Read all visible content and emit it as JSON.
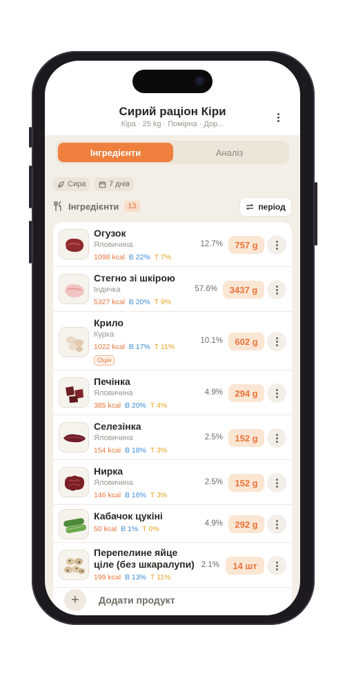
{
  "header": {
    "title": "Сирий раціон Кіри",
    "subtitle": "Кіра · 25 kg · Помірна · Дор..."
  },
  "tabs": [
    {
      "label": "Інгредієнти",
      "active": true
    },
    {
      "label": "Аналіз",
      "active": false
    }
  ],
  "chips": [
    {
      "label": "Сира",
      "icon": "leaf-icon"
    },
    {
      "label": "7 днів",
      "icon": "calendar-icon"
    }
  ],
  "section": {
    "title": "Інгредієнти",
    "count": "13",
    "period_label": "період"
  },
  "ingredients": [
    {
      "name": "Огузок",
      "category": "Яловичина",
      "kcal": "1098 kcal",
      "protein": "В 22%",
      "fat": "Т 7%",
      "pct": "12.7%",
      "qty": "757 g"
    },
    {
      "name": "Стегно зі шкірою",
      "category": "Індичка",
      "kcal": "5327 kcal",
      "protein": "В 20%",
      "fat": "Т 9%",
      "pct": "57.6%",
      "qty": "3437 g"
    },
    {
      "name": "Крило",
      "category": "Курка",
      "kcal": "1022 kcal",
      "protein": "В 17%",
      "fat": "Т 11%",
      "pct": "10.1%",
      "qty": "602 g",
      "note": "Оцін"
    },
    {
      "name": "Печінка",
      "category": "Яловичина",
      "kcal": "385 kcal",
      "protein": "В 20%",
      "fat": "Т 4%",
      "pct": "4.9%",
      "qty": "294 g"
    },
    {
      "name": "Селезінка",
      "category": "Яловичина",
      "kcal": "154 kcal",
      "protein": "В 18%",
      "fat": "Т 3%",
      "pct": "2.5%",
      "qty": "152 g"
    },
    {
      "name": "Нирка",
      "category": "Яловичина",
      "kcal": "146 kcal",
      "protein": "В 16%",
      "fat": "Т 3%",
      "pct": "2.5%",
      "qty": "152 g"
    },
    {
      "name": "Кабачок цукіні",
      "category": "",
      "kcal": "50 kcal",
      "protein": "В 1%",
      "fat": "Т 0%",
      "pct": "4.9%",
      "qty": "292 g"
    },
    {
      "name": "Перепелине яйце ціле (без шкаралупи)",
      "category": "",
      "kcal": "199 kcal",
      "protein": "В 13%",
      "fat": "Т 11%",
      "pct": "2.1%",
      "qty": "14 шт"
    }
  ],
  "add_product": {
    "label": "Додати продукт",
    "icon": "plus-icon"
  },
  "colors": {
    "accent": "#ef7f3c",
    "background": "#f4efe6",
    "protein": "#3b8ad8",
    "fat": "#e6a21c"
  }
}
